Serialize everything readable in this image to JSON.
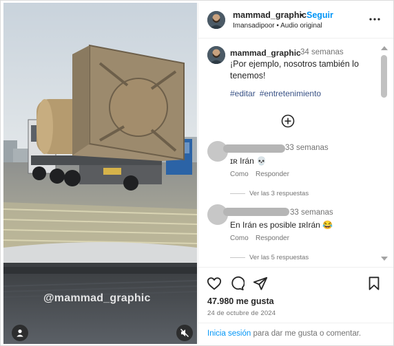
{
  "video": {
    "watermark": "@mammad_graphic",
    "icons": {
      "user": "user-icon",
      "mute": "speaker-muted-icon"
    }
  },
  "header": {
    "username": "mammad_graphic",
    "separator": "•",
    "follow_label": "Seguir",
    "subtitle": "Imansadipoor • Audio original"
  },
  "caption": {
    "username": "mammad_graphic",
    "time": "34 semanas",
    "text": "¡Por ejemplo, nosotros también lo tenemos!",
    "hashtags": [
      "#editar",
      "#entretenimiento"
    ]
  },
  "comments": [
    {
      "time": "33 semanas",
      "text": "ɪʀ Irán 💀",
      "like_label": "Como",
      "reply_label": "Responder",
      "view_replies": "Ver las 3 respuestas"
    },
    {
      "time": "33 semanas",
      "text": "En Irán es posible ɪʀIrán 😂",
      "like_label": "Como",
      "reply_label": "Responder",
      "view_replies": "Ver las 5 respuestas"
    }
  ],
  "actions": {
    "likes": "47.980 me gusta",
    "date": "24 de octubre de 2024"
  },
  "login": {
    "link_text": "Inicia sesión",
    "rest_text": " para dar me gusta o comentar."
  },
  "colors": {
    "link_blue": "#0095f6",
    "hashtag_blue": "#385185",
    "text_gray": "#737373"
  }
}
